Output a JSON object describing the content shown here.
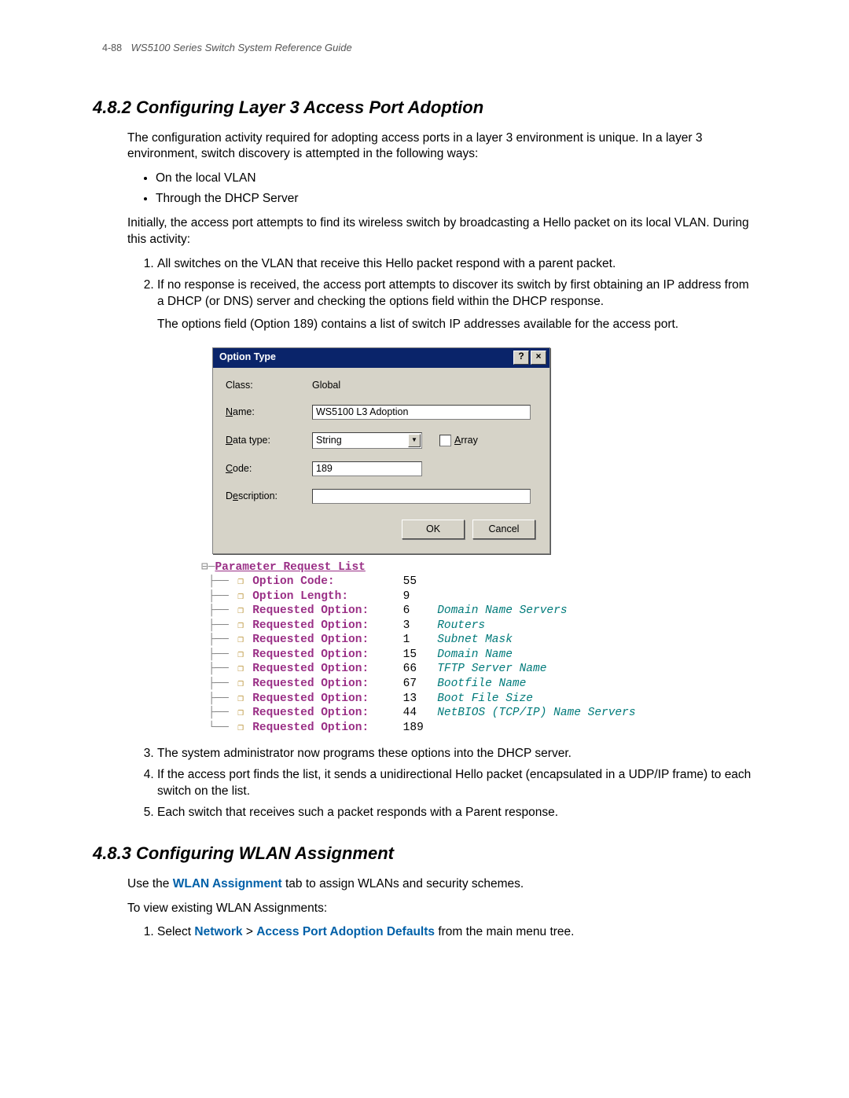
{
  "page_header": {
    "number": "4-88",
    "title": "WS5100 Series Switch System Reference Guide"
  },
  "sec482": {
    "heading": "4.8.2  Configuring Layer 3 Access Port Adoption",
    "p1": "The configuration activity required for adopting access ports in a layer 3 environment is unique. In a layer 3 environment, switch discovery is attempted in the following ways:",
    "bullets": {
      "b1": "On the local VLAN",
      "b2": "Through the DHCP Server"
    },
    "p2": "Initially, the access port attempts to find its wireless switch by broadcasting a Hello packet on its local VLAN. During this activity:",
    "steps": {
      "s1": "All switches on the VLAN that receive this Hello packet respond with a parent packet.",
      "s2": "If no response is received, the access port attempts to discover its switch by first obtaining an IP address from a DHCP (or DNS) server and checking the options field within the DHCP response.",
      "s2b": "The options field (Option 189) contains a list of switch IP addresses available for the access port.",
      "s3": "The system administrator now programs these options into the DHCP server.",
      "s4": "If the access port finds the list, it sends a unidirectional Hello packet (encapsulated in a UDP/IP frame) to each switch on the list.",
      "s5": "Each switch that receives such a packet responds with a Parent response."
    }
  },
  "dialog": {
    "title": "Option Type",
    "labels": {
      "class": "Class:",
      "name": "Name:",
      "datatype": "Data type:",
      "code": "Code:",
      "description": "Description:",
      "array": "Array"
    },
    "values": {
      "class": "Global",
      "name": "WS5100 L3 Adoption",
      "datatype": "String",
      "code": "189",
      "description": ""
    },
    "buttons": {
      "ok": "OK",
      "cancel": "Cancel"
    }
  },
  "tree": {
    "root": "Parameter Request List",
    "rows": [
      {
        "k": "Option Code:",
        "v": "55",
        "d": ""
      },
      {
        "k": "Option Length:",
        "v": "9",
        "d": ""
      },
      {
        "k": "Requested Option:",
        "v": "6",
        "d": "Domain Name Servers"
      },
      {
        "k": "Requested Option:",
        "v": "3",
        "d": "Routers"
      },
      {
        "k": "Requested Option:",
        "v": "1",
        "d": "Subnet Mask"
      },
      {
        "k": "Requested Option:",
        "v": "15",
        "d": "Domain Name"
      },
      {
        "k": "Requested Option:",
        "v": "66",
        "d": "TFTP Server Name"
      },
      {
        "k": "Requested Option:",
        "v": "67",
        "d": "Bootfile Name"
      },
      {
        "k": "Requested Option:",
        "v": "13",
        "d": "Boot File Size"
      },
      {
        "k": "Requested Option:",
        "v": "44",
        "d": "NetBIOS (TCP/IP) Name Servers"
      },
      {
        "k": "Requested Option:",
        "v": "189",
        "d": ""
      }
    ]
  },
  "sec483": {
    "heading": "4.8.3  Configuring WLAN Assignment",
    "p1_pre": "Use the ",
    "p1_link": "WLAN Assignment",
    "p1_post": " tab to assign WLANs and security schemes.",
    "p2": "To view existing WLAN Assignments:",
    "s1_pre": "Select ",
    "s1_l1": "Network",
    "s1_gt": " > ",
    "s1_l2": "Access Port Adoption Defaults",
    "s1_post": " from the main menu tree."
  }
}
